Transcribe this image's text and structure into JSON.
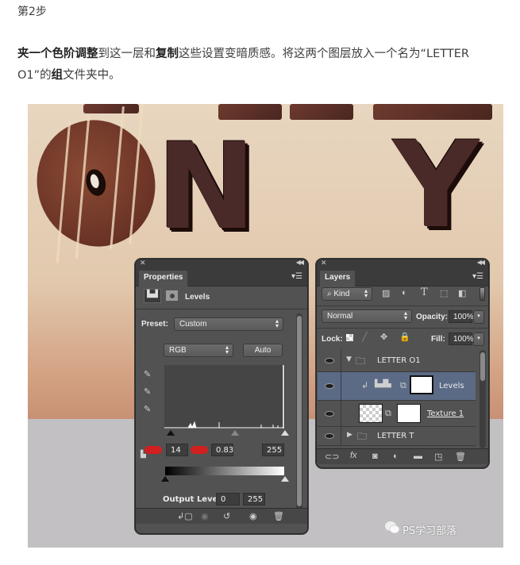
{
  "article": {
    "step_title": "第2步",
    "paragraph": [
      {
        "text": "夹一个",
        "bold": true
      },
      {
        "text": "色阶调整",
        "bold": true
      },
      {
        "text": "到这一层和",
        "bold": false
      },
      {
        "text": "复制",
        "bold": true
      },
      {
        "text": "这些设置变暗质感。将这两个图层放入一个名为“LETTER O1”的",
        "bold": false
      },
      {
        "text": "组",
        "bold": true
      },
      {
        "text": "文件夹中。",
        "bold": false
      }
    ]
  },
  "canvas": {
    "letters": [
      "N",
      "Y"
    ]
  },
  "properties_panel": {
    "tab": "Properties",
    "adjustment_name": "Levels",
    "preset_label": "Preset:",
    "preset_value": "Custom",
    "channel_value": "RGB",
    "auto_label": "Auto",
    "input_black": "14",
    "input_gamma": "0.83",
    "input_white": "255",
    "output_label": "Output Levels:",
    "output_black": "0",
    "output_white": "255"
  },
  "layers_panel": {
    "tab": "Layers",
    "filter_kind": "Kind",
    "blend_mode": "Normal",
    "opacity_label": "Opacity:",
    "opacity_value": "100%",
    "lock_label": "Lock:",
    "fill_label": "Fill:",
    "fill_value": "100%",
    "layers": [
      {
        "name": "LETTER O1",
        "type": "group",
        "expanded": true,
        "selected": false
      },
      {
        "name": "Levels",
        "type": "adjustment",
        "clipped": true,
        "selected": true
      },
      {
        "name": "Texture 1",
        "type": "pixel-with-mask",
        "selected": false
      },
      {
        "name": "LETTER T",
        "type": "group",
        "expanded": false,
        "selected": false
      }
    ]
  },
  "watermark": {
    "text": "PS学习部落"
  }
}
